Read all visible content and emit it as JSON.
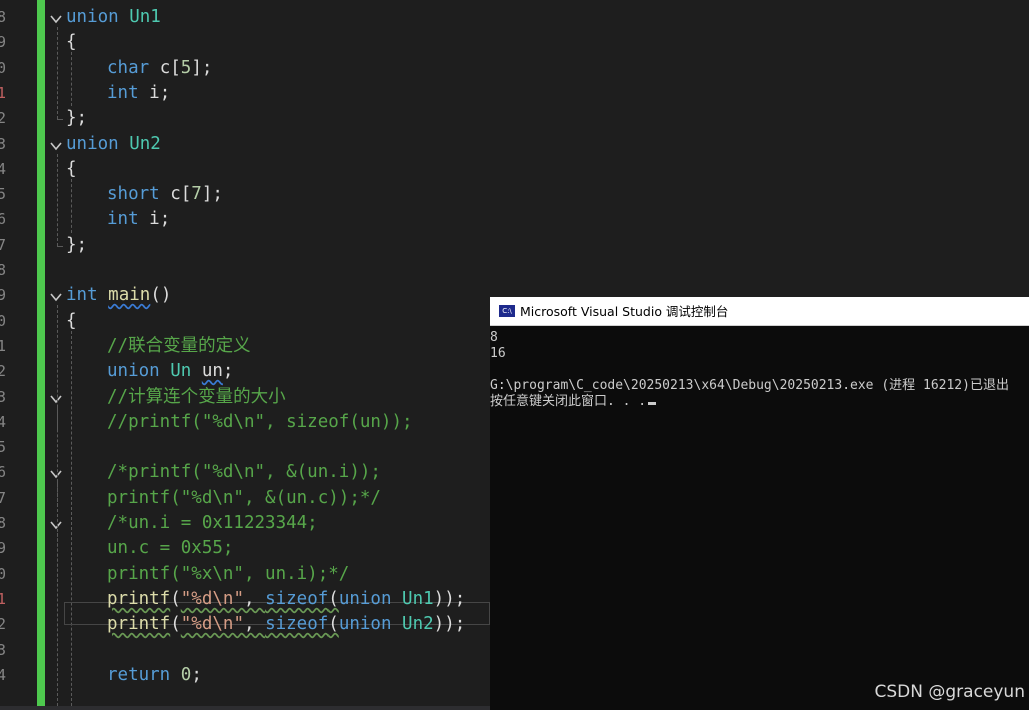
{
  "line_numbers": [
    "8",
    "9",
    "0",
    "1",
    "2",
    "3",
    "4",
    "5",
    "6",
    "7",
    "8",
    "9",
    "0",
    "1",
    "2",
    "3",
    "4",
    "5",
    "6",
    "7",
    "8",
    "9",
    "0",
    "1",
    "2",
    "3",
    "4"
  ],
  "colors": {
    "editor_bg": "#1e1e1e",
    "change_bar": "#4ec94e",
    "keyword": "#569cd6",
    "type": "#4ec9b0",
    "function": "#dcdcaa",
    "comment": "#57a64a",
    "string": "#d69d85",
    "number": "#b5cea8",
    "console_bg": "#0c0c0c",
    "console_title_bg": "#ffffff"
  },
  "code": {
    "l0": [
      {
        "text": "union ",
        "cls": "kw"
      },
      {
        "text": "Un1",
        "cls": "ty"
      }
    ],
    "l1": [
      {
        "text": "{",
        "cls": "pl"
      }
    ],
    "l2": [
      {
        "text": "char ",
        "cls": "kw"
      },
      {
        "text": "c[",
        "cls": "pl"
      },
      {
        "text": "5",
        "cls": "nm"
      },
      {
        "text": "];",
        "cls": "pl"
      }
    ],
    "l3": [
      {
        "text": "int ",
        "cls": "kw"
      },
      {
        "text": "i;",
        "cls": "pl"
      }
    ],
    "l4": [
      {
        "text": "};",
        "cls": "pl"
      }
    ],
    "l5": [
      {
        "text": "union ",
        "cls": "kw"
      },
      {
        "text": "Un2",
        "cls": "ty"
      }
    ],
    "l6": [
      {
        "text": "{",
        "cls": "pl"
      }
    ],
    "l7": [
      {
        "text": "short ",
        "cls": "kw"
      },
      {
        "text": "c[",
        "cls": "pl"
      },
      {
        "text": "7",
        "cls": "nm"
      },
      {
        "text": "];",
        "cls": "pl"
      }
    ],
    "l8": [
      {
        "text": "int ",
        "cls": "kw"
      },
      {
        "text": "i;",
        "cls": "pl"
      }
    ],
    "l9": [
      {
        "text": "};",
        "cls": "pl"
      }
    ],
    "l10": [],
    "l11": [
      {
        "text": "int ",
        "cls": "kw"
      },
      {
        "text": "main",
        "cls": "fn"
      },
      {
        "text": "()",
        "cls": "pl"
      }
    ],
    "l12": [
      {
        "text": "{",
        "cls": "pl"
      }
    ],
    "l13": [
      {
        "text": "//联合变量的定义",
        "cls": "cm"
      }
    ],
    "l14": [
      {
        "text": "union ",
        "cls": "kw"
      },
      {
        "text": "Un ",
        "cls": "ty"
      },
      {
        "text": "un",
        "cls": "pl"
      },
      {
        "text": ";",
        "cls": "pl"
      }
    ],
    "l15": [
      {
        "text": "//计算连个变量的大小",
        "cls": "cm"
      }
    ],
    "l16": [
      {
        "text": "//printf(\"%d\\n\", sizeof(un));",
        "cls": "cm"
      }
    ],
    "l17": [],
    "l18": [
      {
        "text": "/*printf(\"%d\\n\", &(un.i));",
        "cls": "cm"
      }
    ],
    "l19": [
      {
        "text": "printf(\"%d\\n\", &(un.c));*/",
        "cls": "cm"
      }
    ],
    "l20": [
      {
        "text": "/*un.i = 0x11223344;",
        "cls": "cm"
      }
    ],
    "l21": [
      {
        "text": "un.c = 0x55;",
        "cls": "cm"
      }
    ],
    "l22": [
      {
        "text": "printf(\"%x\\n\", un.i);*/",
        "cls": "cm"
      }
    ],
    "l23": [
      {
        "text": "printf",
        "cls": "fn"
      },
      {
        "text": "(",
        "cls": "pl"
      },
      {
        "text": "\"%d\\n\"",
        "cls": "st"
      },
      {
        "text": ", ",
        "cls": "pl"
      },
      {
        "text": "sizeof",
        "cls": "kw"
      },
      {
        "text": "(",
        "cls": "pl"
      },
      {
        "text": "union ",
        "cls": "kw"
      },
      {
        "text": "Un1",
        "cls": "ty"
      },
      {
        "text": "));",
        "cls": "pl"
      }
    ],
    "l24": [
      {
        "text": "printf",
        "cls": "fn"
      },
      {
        "text": "(",
        "cls": "pl"
      },
      {
        "text": "\"%d\\n\"",
        "cls": "st"
      },
      {
        "text": ", ",
        "cls": "pl"
      },
      {
        "text": "sizeof",
        "cls": "kw"
      },
      {
        "text": "(",
        "cls": "pl"
      },
      {
        "text": "union ",
        "cls": "kw"
      },
      {
        "text": "Un2",
        "cls": "ty"
      },
      {
        "text": "));",
        "cls": "pl"
      }
    ],
    "l25": [],
    "l26": [
      {
        "text": "return ",
        "cls": "kw"
      },
      {
        "text": "0",
        "cls": "nm"
      },
      {
        "text": ";",
        "cls": "pl"
      }
    ]
  },
  "console": {
    "title": "Microsoft Visual Studio 调试控制台",
    "icon_text": "C:\\",
    "lines": [
      "8",
      "16",
      "",
      "G:\\program\\C_code\\20250213\\x64\\Debug\\20250213.exe (进程 16212)已退出",
      "按任意键关闭此窗口. . ."
    ]
  },
  "watermark": "CSDN @graceyun"
}
